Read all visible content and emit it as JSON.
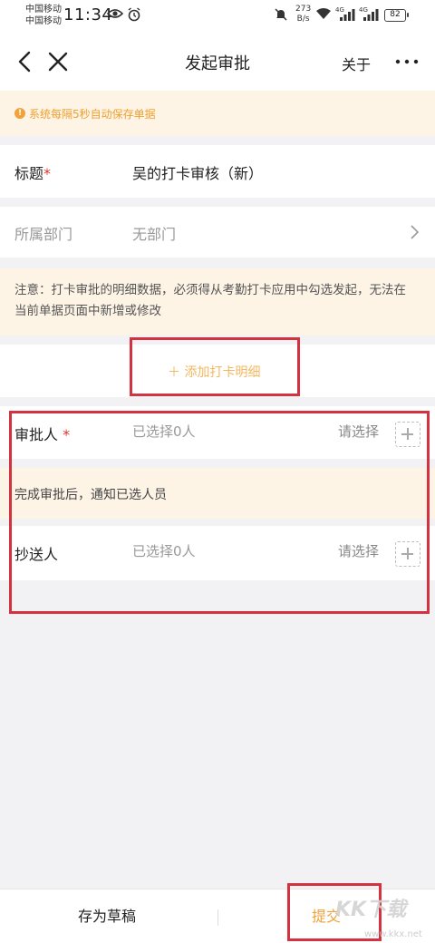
{
  "status_bar": {
    "carrier1": "中国移动",
    "carrier2": "中国移动",
    "time": "11:34",
    "speed_value": "273",
    "speed_unit": "B/s",
    "net1": "4G",
    "net2": "4G",
    "battery": "82"
  },
  "nav": {
    "title": "发起审批",
    "about": "关于"
  },
  "notice": {
    "text": "系统每隔5秒自动保存单据"
  },
  "form": {
    "title_label": "标题",
    "required_mark": "*",
    "title_value": "吴的打卡审核（新）",
    "dept_label": "所属部门",
    "dept_value": "无部门"
  },
  "warning": {
    "text": "注意：打卡审批的明细数据，必须得从考勤打卡应用中勾选发起，无法在当前单据页面中新增或修改"
  },
  "add_detail": {
    "label": "＋ 添加打卡明细"
  },
  "approver": {
    "label": "审批人",
    "required_mark": "*",
    "selected": "已选择0人",
    "choose": "请选择"
  },
  "notify_hint": "完成审批后，通知已选人员",
  "cc": {
    "label": "抄送人",
    "selected": "已选择0人",
    "choose": "请选择"
  },
  "footer": {
    "save_draft": "存为草稿",
    "submit": "提交"
  },
  "watermark": {
    "text": "KK下载",
    "url": "www.kkx.net"
  },
  "colors": {
    "accent": "#f1a23a",
    "required": "#e0352b",
    "highlight_box": "#d33340",
    "notice_bg": "#fdf4e6"
  }
}
